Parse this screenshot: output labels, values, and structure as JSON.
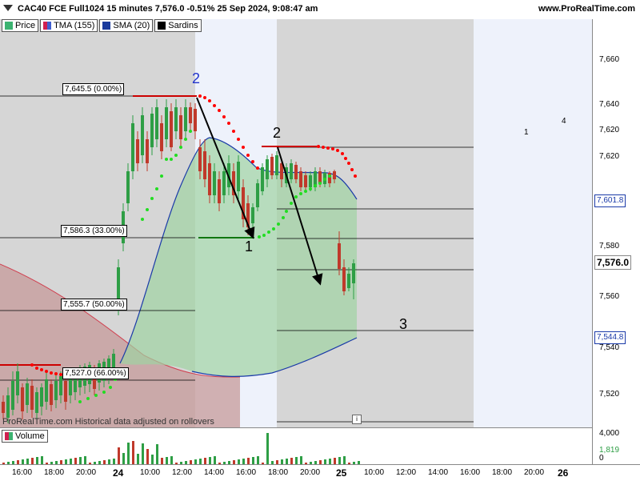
{
  "header": {
    "title": "CAC40 FCE Full1024 15 minutes 7,576.0 -0.51% 25 Sep 2024, 9:08:47 am",
    "site": "www.ProRealTime.com"
  },
  "legend": [
    {
      "label": "Price",
      "color": "#3cb371"
    },
    {
      "label": "TMA (155)",
      "color": "#d02050"
    },
    {
      "label": "SMA (20)",
      "color": "#1a3a9c"
    },
    {
      "label": "Sardins",
      "color": "#000000"
    }
  ],
  "price_axis": {
    "ticks": [
      "7,660",
      "7,640",
      "7,620",
      "7,601.8",
      "7,580",
      "7,576.0",
      "7,560",
      "7,544.8",
      "7,540",
      "7,520"
    ],
    "current_price": "7,576.0",
    "sma_price": "7,601.8",
    "lower_price": "7,544.8"
  },
  "fibonacci": [
    {
      "label": "7,645.5 (0.00%)"
    },
    {
      "label": "7,586.3 (33.00%)"
    },
    {
      "label": "7,555.7 (50.00%)"
    },
    {
      "label": "7,527.0 (66.00%)"
    }
  ],
  "annotations": {
    "wave_2_blue": "2",
    "wave_1": "1",
    "wave_2_black": "2",
    "wave_3": "3",
    "far_1": "1",
    "far_4": "4"
  },
  "footer_note": "ProRealTime.com  Historical data adjusted on rollovers",
  "volume": {
    "label": "Volume",
    "axis_ticks": [
      "4,000",
      "1,819",
      "0"
    ],
    "current": "1,819"
  },
  "time_axis": {
    "labels": [
      "16:00",
      "18:00",
      "20:00",
      "24",
      "10:00",
      "12:00",
      "14:00",
      "16:00",
      "18:00",
      "20:00",
      "25",
      "10:00",
      "12:00",
      "14:00",
      "16:00",
      "18:00",
      "20:00",
      "26"
    ]
  },
  "colors": {
    "up": "#2e9e45",
    "down": "#c0392b",
    "tma": "#d04050",
    "sma": "#1a3aa8",
    "sardins_red": "#ff0000",
    "sardins_green": "#22dd22",
    "fill_green": "#9fd3a3",
    "fill_red": "#c59a9a"
  }
}
